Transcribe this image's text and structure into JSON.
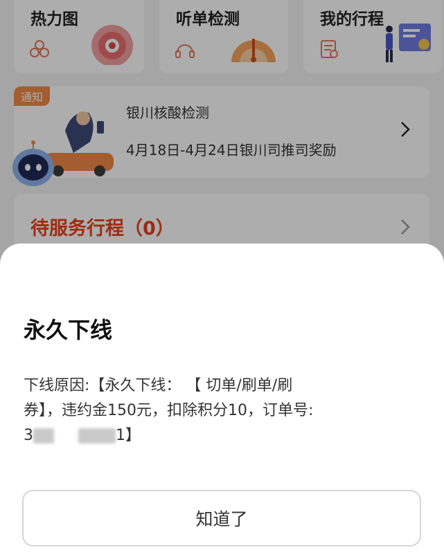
{
  "tiles": [
    {
      "title": "热力图"
    },
    {
      "title": "听单检测"
    },
    {
      "title": "我的行程"
    }
  ],
  "notice": {
    "badge": "通知",
    "title": "银川核酸检测",
    "description": "4月18日-4月24日银川司推司奖励"
  },
  "pending": {
    "label": "待服务行程（0）"
  },
  "dialog": {
    "title": "永久下线",
    "reason_line1": "下线原因:【永久下线：  【 切单/刷单/刷",
    "reason_line2": "券】，违约金150元，扣除积分10，订单号:",
    "order_prefix": "3",
    "order_suffix": "1】",
    "confirm_label": "知道了"
  },
  "colors": {
    "accent_red": "#e8411b",
    "badge_orange": "#f08a45"
  },
  "icons": [
    "heatmap-icon",
    "listen-check-icon",
    "trips-icon",
    "robot-assistant-icon",
    "chevron-right-icon"
  ]
}
